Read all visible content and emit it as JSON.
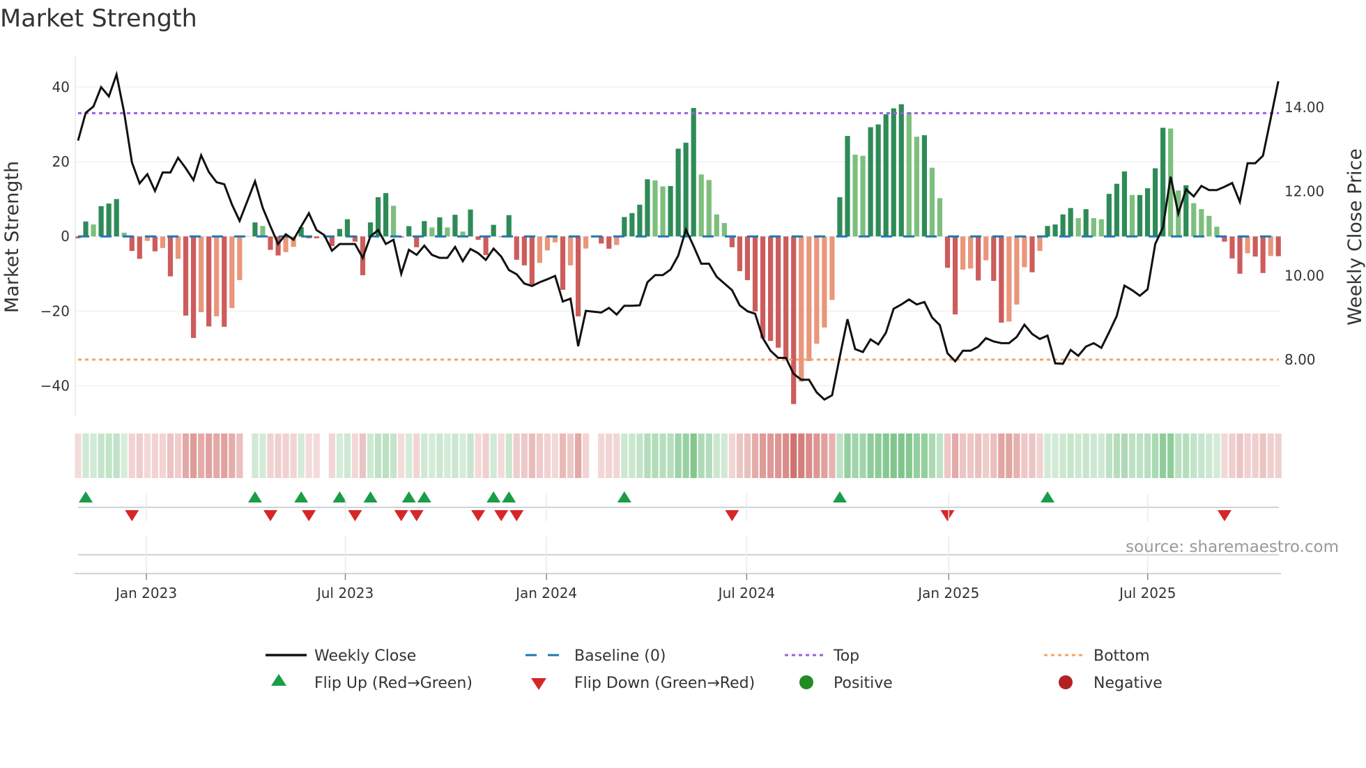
{
  "chart_data": {
    "type": "bar",
    "title": "Market Strength",
    "ylabel": "Market Strength",
    "y2label": "Weekly Close Price",
    "ylim": [
      -48.3,
      48.2
    ],
    "y2lim": [
      6.64,
      15.21
    ],
    "yticks": [
      40,
      20,
      0,
      -20,
      -40
    ],
    "ytick_labels": [
      "40",
      "20",
      "0",
      "−20",
      "−40"
    ],
    "y2ticks": [
      14,
      12,
      10,
      8
    ],
    "y2tick_labels": [
      "14.00",
      "12.00",
      "10.00",
      "8.00"
    ],
    "x_unit": "week index",
    "x_ticks": [
      {
        "label": "Jan 2023",
        "week": 8.88
      },
      {
        "label": "Jul 2023",
        "week": 34.74
      },
      {
        "label": "Jan 2024",
        "week": 60.88
      },
      {
        "label": "Jul 2024",
        "week": 86.9
      },
      {
        "label": "Jan 2025",
        "week": 113.16
      },
      {
        "label": "Jul 2025",
        "week": 139.02
      }
    ],
    "top_level": 33,
    "bottom_level": -33,
    "baseline": 0,
    "grid": true,
    "legend_position": "bottom",
    "source": "source: sharemaestro.com",
    "colors": {
      "pos_strong": "#2e8b57",
      "pos_weak": "#7dbf7d",
      "neg_strong": "#cd5c5c",
      "neg_weak": "#e9967a",
      "line": "#111111",
      "baseline": "#1f77b4",
      "top": "#9b5de5",
      "bottom": "#f4a460",
      "flip_up": "#1a9c48",
      "flip_down": "#d62728",
      "positive": "#228b22",
      "negative": "#b22222"
    },
    "strength": [
      -0.5,
      4,
      3.2,
      8.1,
      8.8,
      10,
      1,
      -3.9,
      -6,
      -1.2,
      -4,
      -3.1,
      -10.7,
      -6,
      -21.2,
      -27.2,
      -20.3,
      -24.1,
      -21.4,
      -24.2,
      -19.2,
      -11.7,
      0,
      3.75,
      2.8,
      -3.6,
      -5.1,
      -4.2,
      -2.8,
      2.5,
      -0.5,
      -0.5,
      0,
      -2.6,
      2,
      4.6,
      -1.4,
      -10.4,
      3.75,
      10.5,
      11.6,
      8.2,
      -0.3,
      2.75,
      -2.9,
      4.1,
      2.4,
      5.1,
      2.4,
      5.8,
      1.3,
      7.2,
      -0.9,
      -5,
      3.1,
      -0.2,
      5.7,
      -6.25,
      -7.75,
      -13.1,
      -7.1,
      -3.75,
      -1.6,
      -14.3,
      -7.75,
      -21.4,
      -3.25,
      0,
      -1.9,
      -3.3,
      -2.3,
      5.2,
      6.25,
      8.5,
      15.3,
      15,
      13.4,
      13.5,
      23.5,
      25.1,
      34.4,
      16.6,
      15.1,
      5.9,
      3.6,
      -2.9,
      -9.3,
      -11.7,
      -20.1,
      -27.3,
      -28,
      -29.8,
      -32.9,
      -44.9,
      -38.9,
      -33.4,
      -28.75,
      -24.4,
      -17,
      10.5,
      26.9,
      21.9,
      21.6,
      29.25,
      30,
      32.7,
      34.3,
      35.4,
      33.2,
      26.7,
      27.1,
      18.4,
      10.25,
      -8.4,
      -20.9,
      -8.9,
      -8.6,
      -11.8,
      -6.4,
      -11.9,
      -23.1,
      -22.8,
      -18.25,
      -8.25,
      -9.6,
      -3.9,
      2.8,
      3.2,
      5.9,
      7.6,
      4.9,
      7.3,
      4.9,
      4.6,
      11.4,
      14.1,
      17.4,
      11.1,
      11.1,
      12.9,
      18.25,
      29.1,
      28.9,
      12.3,
      13.7,
      8.9,
      7.3,
      5.5,
      2.6,
      -1.4,
      -5.9,
      -10,
      -4.5,
      -5.4,
      -9.8,
      -5.25,
      -5.3
    ],
    "weekly_close": [
      13.21,
      13.87,
      14.02,
      14.48,
      14.26,
      14.78,
      13.87,
      12.69,
      12.19,
      12.41,
      12.01,
      12.45,
      12.45,
      12.8,
      12.55,
      12.27,
      12.86,
      12.46,
      12.22,
      12.17,
      11.69,
      11.3,
      11.77,
      12.24,
      11.61,
      11.17,
      10.75,
      10.98,
      10.85,
      11.17,
      11.48,
      11.08,
      10.96,
      10.59,
      10.75,
      10.75,
      10.75,
      10.42,
      10.93,
      11.08,
      10.75,
      10.85,
      10.04,
      10.61,
      10.49,
      10.71,
      10.49,
      10.42,
      10.42,
      10.68,
      10.34,
      10.63,
      10.53,
      10.37,
      10.64,
      10.45,
      10.13,
      10.03,
      9.81,
      9.75,
      9.84,
      9.91,
      9.99,
      9.38,
      9.45,
      8.32,
      9.16,
      9.14,
      9.12,
      9.23,
      9.07,
      9.28,
      9.28,
      9.29,
      9.84,
      10.01,
      10.01,
      10.14,
      10.47,
      11.09,
      10.7,
      10.28,
      10.28,
      9.97,
      9.81,
      9.65,
      9.29,
      9.15,
      9.09,
      8.51,
      8.21,
      8.04,
      8.04,
      7.66,
      7.52,
      7.52,
      7.22,
      7.05,
      7.15,
      8.07,
      8.96,
      8.25,
      8.18,
      8.48,
      8.36,
      8.64,
      9.21,
      9.31,
      9.43,
      9.31,
      9.37,
      9.0,
      8.82,
      8.15,
      7.96,
      8.21,
      8.21,
      8.31,
      8.51,
      8.43,
      8.39,
      8.39,
      8.54,
      8.83,
      8.61,
      8.49,
      8.57,
      7.91,
      7.9,
      8.23,
      8.09,
      8.31,
      8.39,
      8.28,
      8.65,
      9.04,
      9.76,
      9.65,
      9.52,
      9.67,
      10.75,
      11.14,
      12.35,
      11.47,
      12.05,
      11.88,
      12.13,
      12.03,
      12.03,
      12.11,
      12.2,
      11.75,
      12.67,
      12.67,
      12.85,
      13.73,
      14.62
    ],
    "legend": [
      {
        "label": "Weekly Close",
        "symbol": "solid-line"
      },
      {
        "label": "Baseline (0)",
        "symbol": "dashed-line"
      },
      {
        "label": "Top",
        "symbol": "dotted-line"
      },
      {
        "label": "Bottom",
        "symbol": "dotted-line"
      },
      {
        "label": "Flip Up (Red→Green)",
        "symbol": "triangle-up"
      },
      {
        "label": "Flip Down (Green→Red)",
        "symbol": "triangle-down"
      },
      {
        "label": "Positive",
        "symbol": "circle"
      },
      {
        "label": "Negative",
        "symbol": "circle"
      }
    ]
  }
}
